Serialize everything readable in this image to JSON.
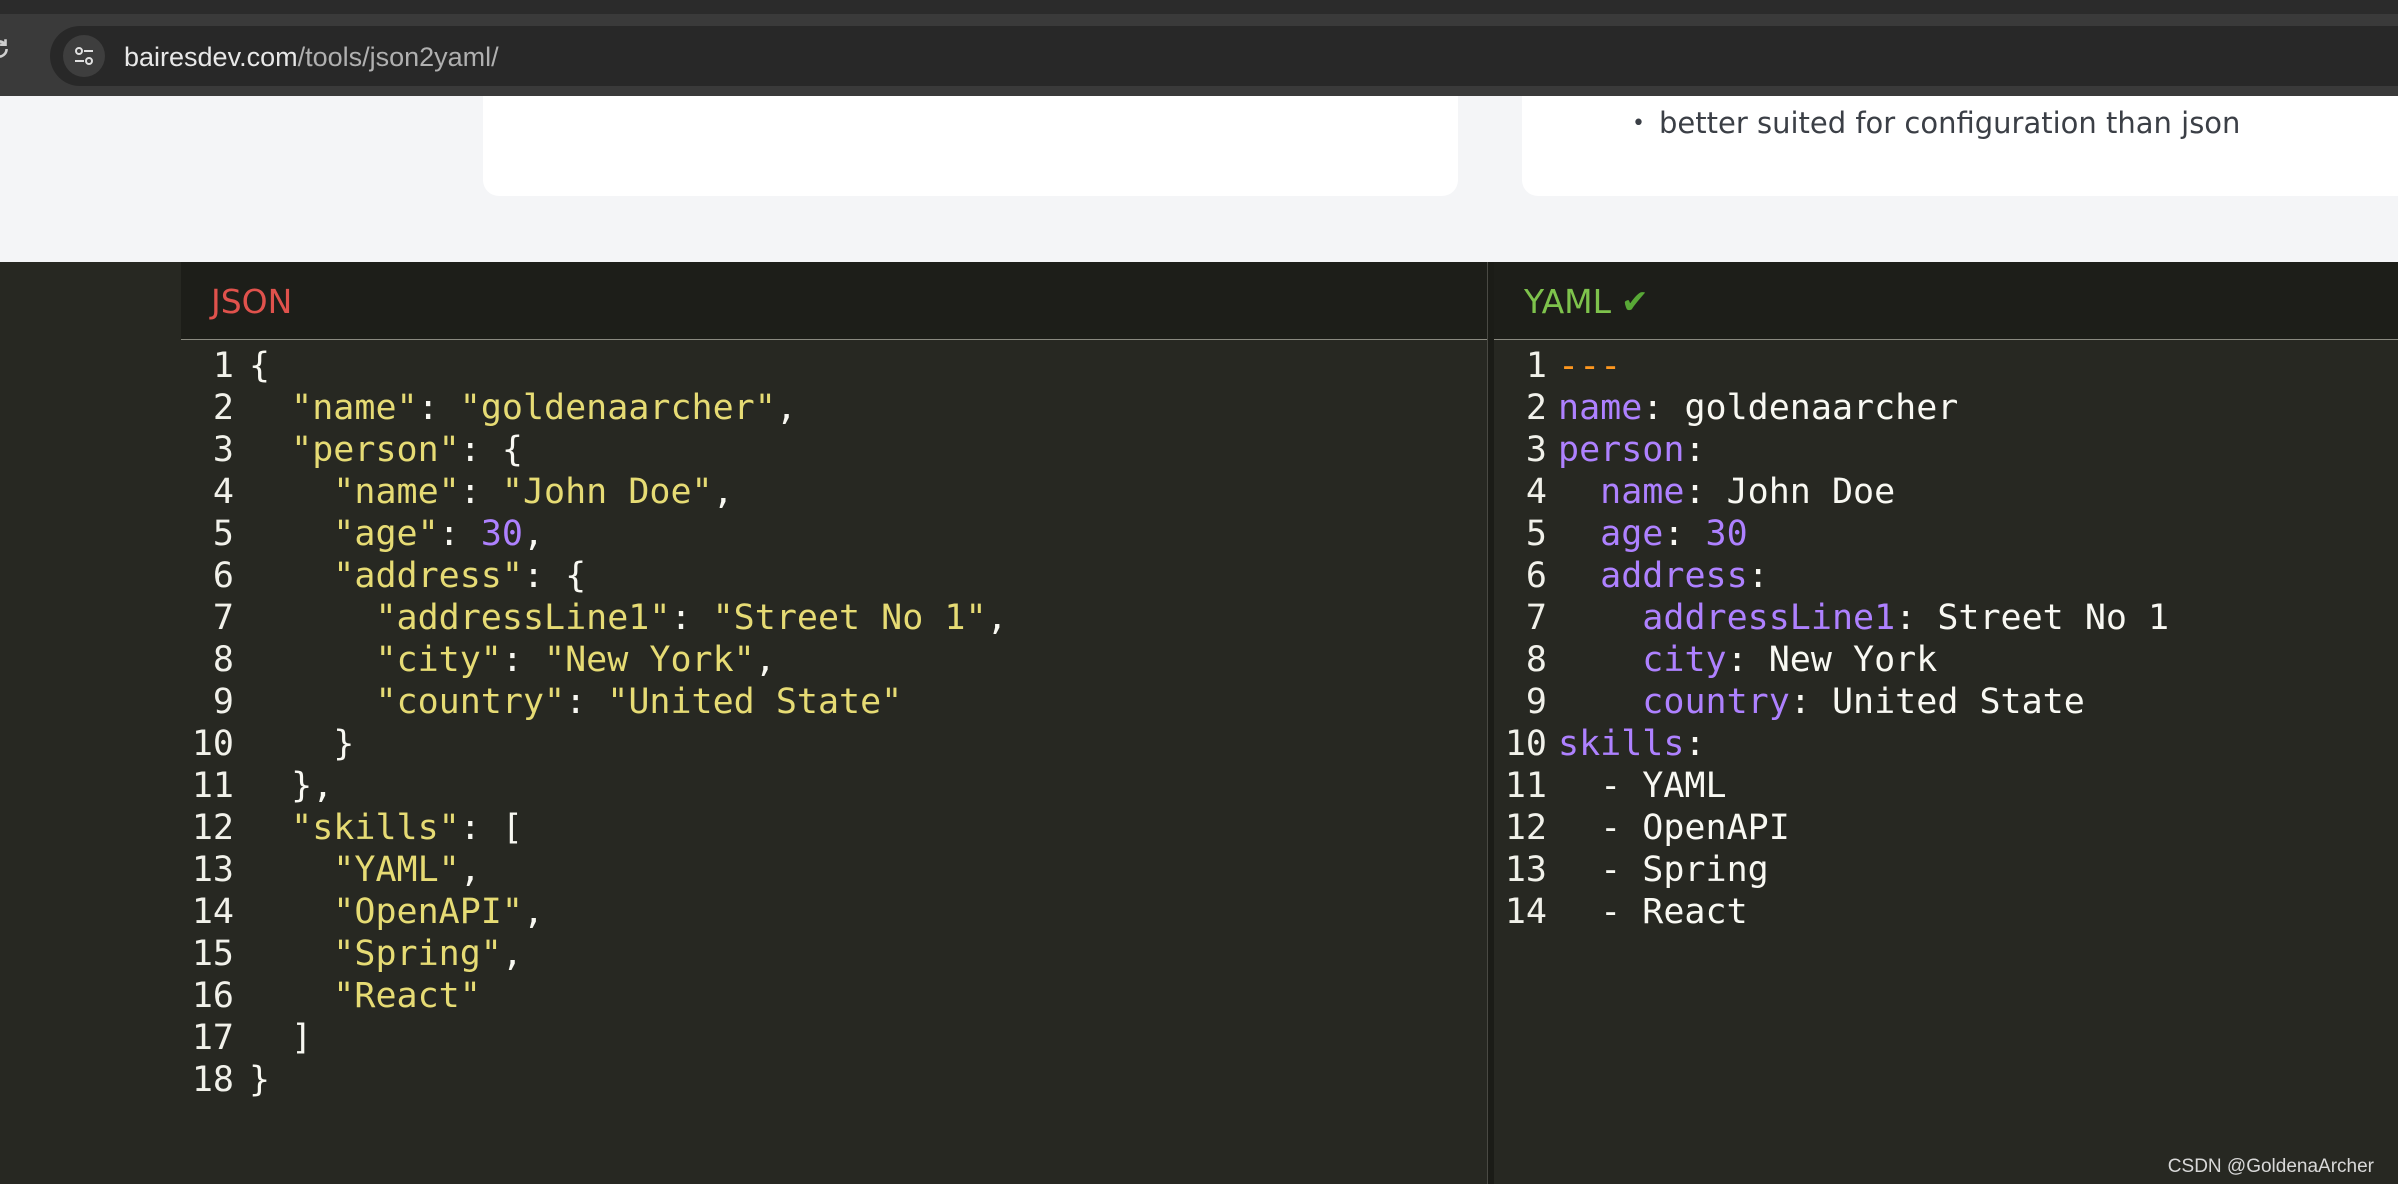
{
  "browser": {
    "url_host": "bairesdev.com",
    "url_path": "/tools/json2yaml/"
  },
  "page": {
    "right_card_bullet": "better suited for configuration than json"
  },
  "json_panel": {
    "title": "JSON",
    "lines": [
      [
        {
          "t": "p",
          "v": "{"
        }
      ],
      [
        {
          "t": "p",
          "v": "  "
        },
        {
          "t": "s",
          "v": "\"name\""
        },
        {
          "t": "p",
          "v": ": "
        },
        {
          "t": "s",
          "v": "\"goldenaarcher\""
        },
        {
          "t": "p",
          "v": ","
        }
      ],
      [
        {
          "t": "p",
          "v": "  "
        },
        {
          "t": "s",
          "v": "\"person\""
        },
        {
          "t": "p",
          "v": ": {"
        }
      ],
      [
        {
          "t": "p",
          "v": "    "
        },
        {
          "t": "s",
          "v": "\"name\""
        },
        {
          "t": "p",
          "v": ": "
        },
        {
          "t": "s",
          "v": "\"John Doe\""
        },
        {
          "t": "p",
          "v": ","
        }
      ],
      [
        {
          "t": "p",
          "v": "    "
        },
        {
          "t": "s",
          "v": "\"age\""
        },
        {
          "t": "p",
          "v": ": "
        },
        {
          "t": "n",
          "v": "30"
        },
        {
          "t": "p",
          "v": ","
        }
      ],
      [
        {
          "t": "p",
          "v": "    "
        },
        {
          "t": "s",
          "v": "\"address\""
        },
        {
          "t": "p",
          "v": ": {"
        }
      ],
      [
        {
          "t": "p",
          "v": "      "
        },
        {
          "t": "s",
          "v": "\"addressLine1\""
        },
        {
          "t": "p",
          "v": ": "
        },
        {
          "t": "s",
          "v": "\"Street No 1\""
        },
        {
          "t": "p",
          "v": ","
        }
      ],
      [
        {
          "t": "p",
          "v": "      "
        },
        {
          "t": "s",
          "v": "\"city\""
        },
        {
          "t": "p",
          "v": ": "
        },
        {
          "t": "s",
          "v": "\"New York\""
        },
        {
          "t": "p",
          "v": ","
        }
      ],
      [
        {
          "t": "p",
          "v": "      "
        },
        {
          "t": "s",
          "v": "\"country\""
        },
        {
          "t": "p",
          "v": ": "
        },
        {
          "t": "s",
          "v": "\"United State\""
        }
      ],
      [
        {
          "t": "p",
          "v": "    }"
        }
      ],
      [
        {
          "t": "p",
          "v": "  },"
        }
      ],
      [
        {
          "t": "p",
          "v": "  "
        },
        {
          "t": "s",
          "v": "\"skills\""
        },
        {
          "t": "p",
          "v": ": ["
        }
      ],
      [
        {
          "t": "p",
          "v": "    "
        },
        {
          "t": "s",
          "v": "\"YAML\""
        },
        {
          "t": "p",
          "v": ","
        }
      ],
      [
        {
          "t": "p",
          "v": "    "
        },
        {
          "t": "s",
          "v": "\"OpenAPI\""
        },
        {
          "t": "p",
          "v": ","
        }
      ],
      [
        {
          "t": "p",
          "v": "    "
        },
        {
          "t": "s",
          "v": "\"Spring\""
        },
        {
          "t": "p",
          "v": ","
        }
      ],
      [
        {
          "t": "p",
          "v": "    "
        },
        {
          "t": "s",
          "v": "\"React\""
        }
      ],
      [
        {
          "t": "p",
          "v": "  ]"
        }
      ],
      [
        {
          "t": "p",
          "v": "}"
        }
      ]
    ]
  },
  "yaml_panel": {
    "title": "YAML",
    "status_icon": "✔",
    "lines": [
      [
        {
          "t": "d",
          "v": "---"
        }
      ],
      [
        {
          "t": "k",
          "v": "name"
        },
        {
          "t": "p",
          "v": ": goldenaarcher"
        }
      ],
      [
        {
          "t": "k",
          "v": "person"
        },
        {
          "t": "p",
          "v": ":"
        }
      ],
      [
        {
          "t": "p",
          "v": "  "
        },
        {
          "t": "k",
          "v": "name"
        },
        {
          "t": "p",
          "v": ": John Doe"
        }
      ],
      [
        {
          "t": "p",
          "v": "  "
        },
        {
          "t": "k",
          "v": "age"
        },
        {
          "t": "p",
          "v": ": "
        },
        {
          "t": "n",
          "v": "30"
        }
      ],
      [
        {
          "t": "p",
          "v": "  "
        },
        {
          "t": "k",
          "v": "address"
        },
        {
          "t": "p",
          "v": ":"
        }
      ],
      [
        {
          "t": "p",
          "v": "    "
        },
        {
          "t": "k",
          "v": "addressLine1"
        },
        {
          "t": "p",
          "v": ": Street No 1"
        }
      ],
      [
        {
          "t": "p",
          "v": "    "
        },
        {
          "t": "k",
          "v": "city"
        },
        {
          "t": "p",
          "v": ": New York"
        }
      ],
      [
        {
          "t": "p",
          "v": "    "
        },
        {
          "t": "k",
          "v": "country"
        },
        {
          "t": "p",
          "v": ": United State"
        }
      ],
      [
        {
          "t": "k",
          "v": "skills"
        },
        {
          "t": "p",
          "v": ":"
        }
      ],
      [
        {
          "t": "p",
          "v": "  - YAML"
        }
      ],
      [
        {
          "t": "p",
          "v": "  - OpenAPI"
        }
      ],
      [
        {
          "t": "p",
          "v": "  - Spring"
        }
      ],
      [
        {
          "t": "p",
          "v": "  - React"
        }
      ]
    ]
  },
  "watermark": "CSDN @GoldenaArcher",
  "colors": {
    "json_title": "#e0524c",
    "yaml_title": "#7ec34c",
    "string": "#e6db74",
    "number": "#ae81ff",
    "yaml_key": "#ae81ff",
    "doc_marker": "#fd971f",
    "editor_bg": "#272822"
  }
}
